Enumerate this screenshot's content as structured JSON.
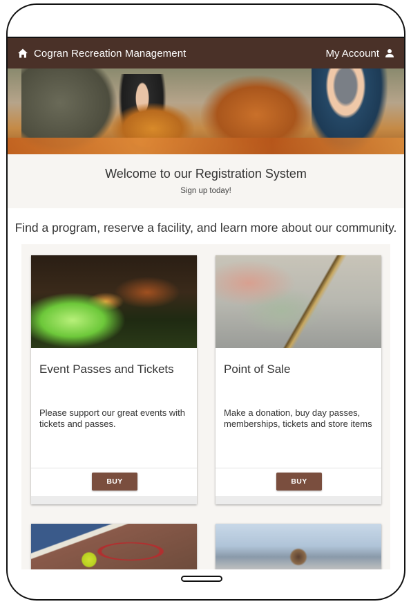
{
  "app": {
    "title": "Cogran Recreation Management",
    "account_label": "My Account",
    "home_icon": "home-icon",
    "account_icon": "person-icon",
    "brand_color": "#4a3128",
    "button_color": "#7a4e3e"
  },
  "welcome": {
    "title": "Welcome to our Registration System",
    "subtitle": "Sign up today!"
  },
  "tagline": "Find a program, reserve a facility, and learn more about our community.",
  "cards": [
    {
      "title": "Event Passes and Tickets",
      "description": "Please support our great events with tickets and passes.",
      "button": "BUY"
    },
    {
      "title": "Point of Sale",
      "description": "Make a donation, buy day passes, memberships, tickets and store items",
      "button": "BUY"
    }
  ]
}
